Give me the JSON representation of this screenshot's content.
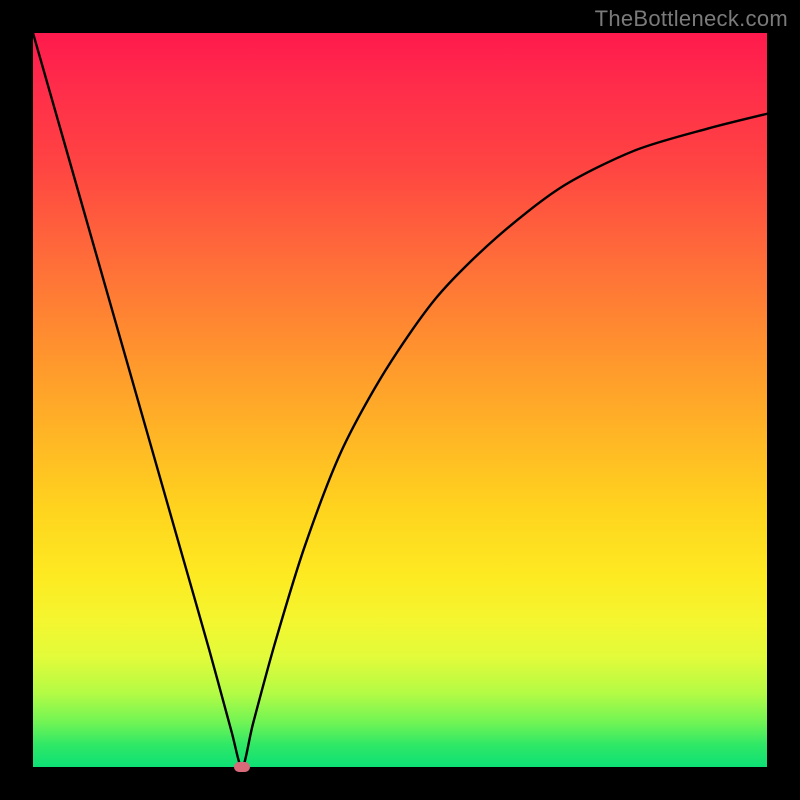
{
  "watermark": "TheBottleneck.com",
  "colors": {
    "frame": "#000000",
    "curve": "#000000",
    "marker": "#d96a7a"
  },
  "chart_data": {
    "type": "line",
    "title": "",
    "xlabel": "",
    "ylabel": "",
    "xlim": [
      0,
      100
    ],
    "ylim": [
      0,
      100
    ],
    "grid": false,
    "annotation_marker": {
      "x": 28.5,
      "y": 0
    },
    "series": [
      {
        "name": "bottleneck-curve",
        "x": [
          0,
          4,
          8,
          12,
          16,
          20,
          24,
          27,
          28.5,
          30,
          33,
          37,
          42,
          48,
          55,
          63,
          72,
          82,
          92,
          100
        ],
        "values": [
          100,
          86,
          72,
          58,
          44,
          30,
          16,
          5,
          0,
          6,
          17,
          30,
          43,
          54,
          64,
          72,
          79,
          84,
          87,
          89
        ]
      }
    ]
  }
}
